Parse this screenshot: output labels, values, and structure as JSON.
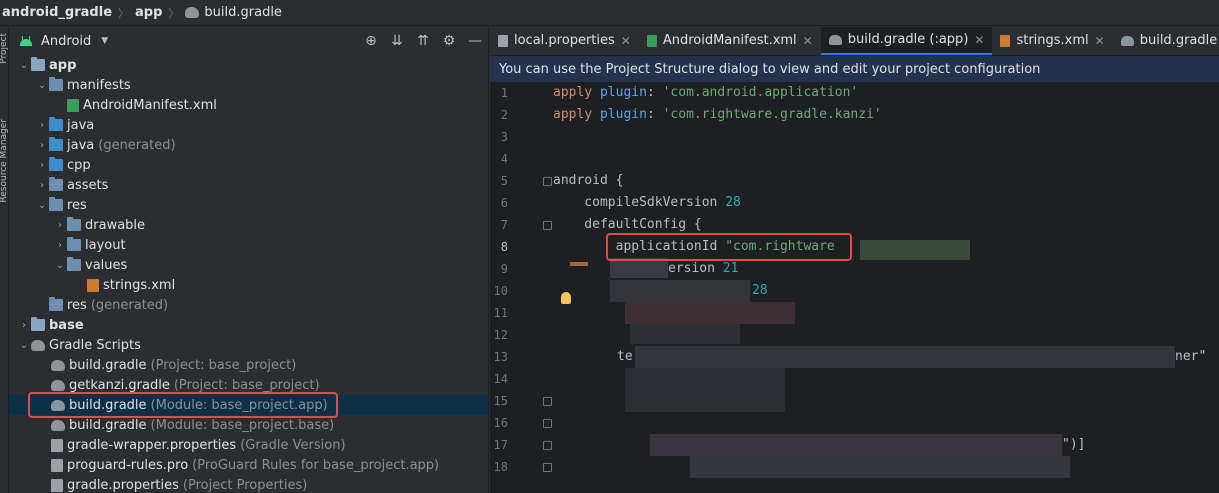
{
  "breadcrumb": {
    "items": [
      "android_gradle",
      "app",
      "build.gradle"
    ]
  },
  "sidestrip": {
    "project_label": "Project",
    "resource_label": "Resource Manager"
  },
  "project_panel": {
    "view_selector": "Android",
    "tree": [
      {
        "name": "app",
        "hint": ""
      },
      {
        "name": "manifests",
        "hint": ""
      },
      {
        "name": "AndroidManifest.xml",
        "hint": ""
      },
      {
        "name": "java",
        "hint": ""
      },
      {
        "name": "java",
        "hint": "(generated)"
      },
      {
        "name": "cpp",
        "hint": ""
      },
      {
        "name": "assets",
        "hint": ""
      },
      {
        "name": "res",
        "hint": ""
      },
      {
        "name": "drawable",
        "hint": ""
      },
      {
        "name": "layout",
        "hint": ""
      },
      {
        "name": "values",
        "hint": ""
      },
      {
        "name": "strings.xml",
        "hint": ""
      },
      {
        "name": "res",
        "hint": "(generated)"
      },
      {
        "name": "base",
        "hint": ""
      },
      {
        "name": "Gradle Scripts",
        "hint": ""
      },
      {
        "name": "build.gradle",
        "hint": "(Project: base_project)"
      },
      {
        "name": "getkanzi.gradle",
        "hint": "(Project: base_project)"
      },
      {
        "name": "build.gradle",
        "hint": "(Module: base_project.app)"
      },
      {
        "name": "build.gradle",
        "hint": "(Module: base_project.base)"
      },
      {
        "name": "gradle-wrapper.properties",
        "hint": "(Gradle Version)"
      },
      {
        "name": "proguard-rules.pro",
        "hint": "(ProGuard Rules for base_project.app)"
      },
      {
        "name": "gradle.properties",
        "hint": "(Project Properties)"
      }
    ]
  },
  "editor": {
    "tabs": [
      {
        "label": "local.properties"
      },
      {
        "label": "AndroidManifest.xml"
      },
      {
        "label": "build.gradle (:app)"
      },
      {
        "label": "strings.xml"
      },
      {
        "label": "build.gradle (:base)"
      }
    ],
    "banner": "You can use the Project Structure dialog to view and edit your project configuration",
    "line_numbers": [
      "1",
      "2",
      "3",
      "4",
      "5",
      "6",
      "7",
      "8",
      "9",
      "10",
      "11",
      "12",
      "13",
      "14",
      "15",
      "16",
      "17",
      "18"
    ],
    "code": {
      "l1_kw": "apply",
      "l1_fn": " plugin",
      "l1_p": ": ",
      "l1_str": "'com.android.application'",
      "l2_kw": "apply",
      "l2_fn": " plugin",
      "l2_p": ": ",
      "l2_str": "'com.rightware.gradle.kanzi'",
      "l5": "android {",
      "l6_a": "    compileSdkVersion ",
      "l6_n": "28",
      "l7": "    defaultConfig {",
      "l8_a": "        applicationId ",
      "l8_s": "\"com.rightware",
      "l9_a": "ersion ",
      "l9_n": "21",
      "l10_n": "28",
      "l13_a": "te",
      "l13_b": "ner\"",
      "l17_a": "\")]"
    }
  },
  "colors": {
    "accent": "#3574f0",
    "highlight_box": "#e24b4b",
    "selection": "#0d3049"
  }
}
